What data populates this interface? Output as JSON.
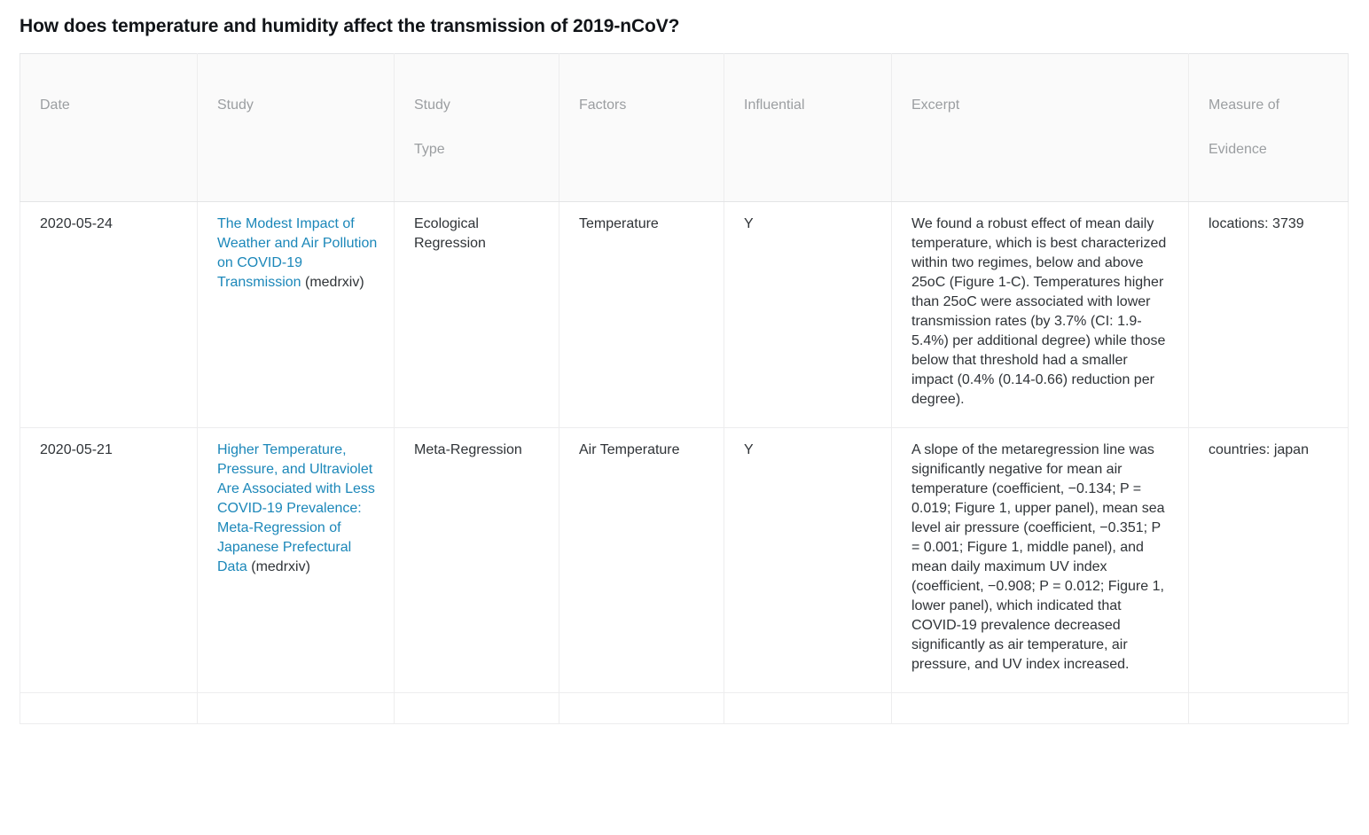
{
  "page": {
    "title": "How does temperature and humidity affect the transmission of 2019-nCoV?"
  },
  "colors": {
    "link": "#1b87b9",
    "text": "#2f3337",
    "header_text": "#9b9ea1",
    "header_bg": "#fafafa",
    "border": "#ededee"
  },
  "table": {
    "headers": [
      {
        "line1": "Date",
        "line2": ""
      },
      {
        "line1": "Study",
        "line2": ""
      },
      {
        "line1": "Study",
        "line2": "Type"
      },
      {
        "line1": "Factors",
        "line2": ""
      },
      {
        "line1": "Influential",
        "line2": ""
      },
      {
        "line1": "Excerpt",
        "line2": ""
      },
      {
        "line1": "Measure of",
        "line2": "Evidence"
      }
    ],
    "rows": [
      {
        "date": "2020-05-24",
        "study_title": "The Modest Impact of Weather and Air Pollution on COVID-19 Transmission",
        "study_source": "(medrxiv)",
        "study_type": "Ecological Regression",
        "factors": "Temperature",
        "influential": "Y",
        "excerpt": "We found a robust effect of mean daily temperature, which is best characterized within two regimes, below and above 25oC (Figure 1-C). Temperatures higher than 25oC were associated with lower transmission rates (by 3.7% (CI: 1.9-5.4%) per additional degree) while those below that threshold had a smaller impact (0.4% (0.14-0.66) reduction per degree).",
        "measure_of_evidence": "locations: 3739"
      },
      {
        "date": "2020-05-21",
        "study_title": "Higher Temperature, Pressure, and Ultraviolet Are Associated with Less COVID-19 Prevalence: Meta-Regression of Japanese Prefectural Data",
        "study_source": "(medrxiv)",
        "study_type": "Meta-Regression",
        "factors": "Air Temperature",
        "influential": "Y",
        "excerpt": "A slope of the metaregression line was significantly negative for mean air temperature (coefficient, −0.134; P = 0.019; Figure 1, upper panel), mean sea level air pressure (coefficient, −0.351; P = 0.001; Figure 1, middle panel), and mean daily maximum UV index (coefficient, −0.908; P = 0.012; Figure 1, lower panel), which indicated that COVID-19 prevalence decreased significantly as air temperature, air pressure, and UV index increased.",
        "measure_of_evidence": "countries: japan"
      },
      {
        "date": "",
        "study_title": "",
        "study_source": "",
        "study_type": "",
        "factors": "",
        "influential": "",
        "excerpt": "",
        "measure_of_evidence": ""
      }
    ]
  }
}
